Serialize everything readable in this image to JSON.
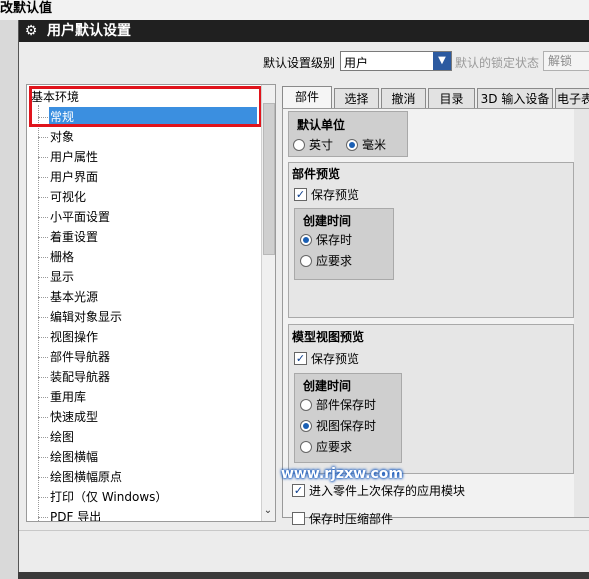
{
  "background_title": "改默认值",
  "dialog": {
    "title": "用户默认设置",
    "level_label": "默认设置级别",
    "level_value": "用户",
    "lock_label": "默认的锁定状态",
    "lock_value": "解锁"
  },
  "tree": {
    "root": "基本环境",
    "items": [
      "常规",
      "对象",
      "用户属性",
      "用户界面",
      "可视化",
      "小平面设置",
      "着重设置",
      "栅格",
      "显示",
      "基本光源",
      "编辑对象显示",
      "视图操作",
      "部件导航器",
      "装配导航器",
      "重用库",
      "快速成型",
      "绘图",
      "绘图横幅",
      "绘图横幅原点",
      "打印（仅 Windows）",
      "PDF 导出"
    ]
  },
  "tabs": [
    "部件",
    "选择",
    "撤消",
    "目录",
    "3D 输入设备",
    "电子表"
  ],
  "panel": {
    "units_title": "默认单位",
    "unit_inch": "英寸",
    "unit_mm": "毫米",
    "part_preview_title": "部件预览",
    "save_preview": "保存预览",
    "create_time_title": "创建时间",
    "on_save": "保存时",
    "on_demand": "应要求",
    "model_preview_title": "模型视图预览",
    "save_preview2": "保存预览",
    "create_time_title2": "创建时间",
    "part_on_save": "部件保存时",
    "view_on_save": "视图保存时",
    "on_demand2": "应要求",
    "enter_last_module": "进入零件上次保存的应用模块",
    "compress_on_save": "保存时压缩部件"
  },
  "watermark": "www.rjzxw.com"
}
